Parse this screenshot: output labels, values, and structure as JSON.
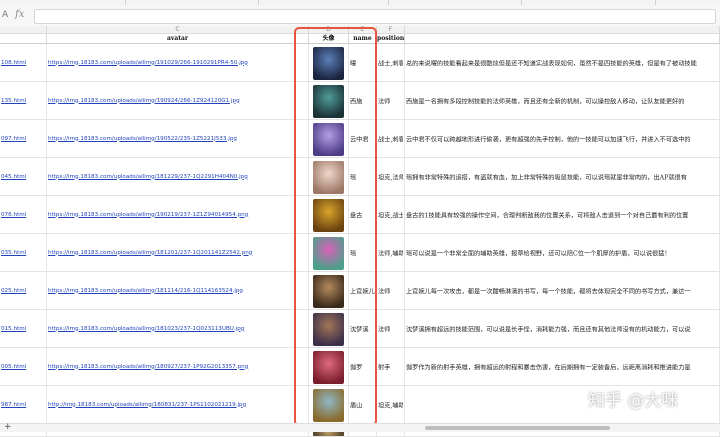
{
  "formula_bar": {
    "cell_ref": "A",
    "fx_label": "fx",
    "value": ""
  },
  "column_letters": [
    {
      "id": "C",
      "label": "C"
    },
    {
      "id": "D",
      "label": "D"
    },
    {
      "id": "E",
      "label": "E"
    },
    {
      "id": "F",
      "label": "F"
    }
  ],
  "headers": {
    "url": "",
    "avatar": "avatar",
    "avatar_cn": "头像",
    "name": "name",
    "position": "position",
    "desc": ""
  },
  "rows": [
    {
      "url": "108.html",
      "avatar_link": "https://img.18183.com/uploads/allimg/191029/266-1910291PR4-50.jpg",
      "name": "曜",
      "position": "战士,刺客",
      "desc": "总的来说曜的技能看起来是很酷炫但是还不知道实战表现如何，虽然不是四技能的英雄，但是有了被动技能",
      "avatar_color": "#5a7fb8",
      "avatar_color2": "#1b2540"
    },
    {
      "url": "135.html",
      "avatar_link": "https://img.18183.com/uploads/allimg/190924/266-1Z924120G1.jpg",
      "name": "西施",
      "position": "法师",
      "desc": "西施是一名拥有多段控制技能的法师英雄，而且还有全新的机制，可以操控敌人移动，让队友能更好的",
      "avatar_color": "#4f9b99",
      "avatar_color2": "#1c3136"
    },
    {
      "url": "097.html",
      "avatar_link": "https://img.18183.com/uploads/allimg/190522/235-1Z5221J533.jpg",
      "name": "云中君",
      "position": "战士,刺客",
      "desc": "云中君不仅可以跨越地形进行偷袭，更有超强的先手控制，他的一技能可以加速飞行，并进入不可选中的",
      "avatar_color": "#b1a0e4",
      "avatar_color2": "#4d3c86"
    },
    {
      "url": "045.html",
      "avatar_link": "https://img.18183.com/uploads/allimg/181229/237-1Q2291H404N0.jpg",
      "name": "瑶",
      "position": "坦克,法师",
      "desc": "瑶拥有非常特殊的追搭，有盗就有血，加上非常特殊的吸鼠技能，可以说瑶就是非常肉的，出AP就很有",
      "avatar_color": "#efd8cb",
      "avatar_color2": "#9c7766"
    },
    {
      "url": "076.html",
      "avatar_link": "https://img.18183.com/uploads/allimg/190219/237-1Z1Z94014954.png",
      "name": "盘古",
      "position": "坦克,战士",
      "desc": "盘古的1技能具有较强的操作空间，合理判断敌我的位置关系，可将敌人击退到一个对自己最有利的位置",
      "avatar_color": "#d9a52c",
      "avatar_color2": "#6a4210"
    },
    {
      "url": "035.html",
      "avatar_link": "https://img.18183.com/uploads/allimg/181201/237-1Q201141Z2542.png",
      "name": "瑶",
      "position": "法师,辅助",
      "desc": "瑶可以说是一个非常全面的辅助英雄，报草给视野，还可以陪C位一个肌厚的护盾，可以说很猛！",
      "avatar_color": "#d861b8",
      "avatar_color2": "#4aa08a"
    },
    {
      "url": "025.html",
      "avatar_link": "https://img.18183.com/uploads/allimg/181114/216-1Q114163524.jpg",
      "name": "上官婉儿",
      "position": "法师",
      "desc": "上官婉儿每一次攻击，都是一次酣畅淋漓的书写，每一个技能，都将去体现完全不同的书写方式，兼达一",
      "avatar_color": "#b38a5d",
      "avatar_color2": "#3a2a1c"
    },
    {
      "url": "015.html",
      "avatar_link": "https://img.18183.com/uploads/allimg/181023/237-1Q023113UBU.jpg",
      "name": "沈梦溪",
      "position": "法师",
      "desc": "沈梦溪拥有超远的技能范围，可以说是长手怪，消耗能力强，而且还有其他法师没有的机动能力，可以说",
      "avatar_color": "#a27658",
      "avatar_color2": "#3b2f4a"
    },
    {
      "url": "005.html",
      "avatar_link": "https://img.18183.com/uploads/allimg/180927/237-1P92G2013357.png",
      "name": "伽罗",
      "position": "射手",
      "desc": "伽罗作为新的射手英雄，拥有超远的射程和暴击伤害，在后期拥有一定装备后，远距离消耗和推进能力是",
      "avatar_color": "#dd6a7c",
      "avatar_color2": "#7a1d2c"
    },
    {
      "url": "987.html",
      "avatar_link": "http://img.18183.com/uploads/allimg/180831/237-1PS1102021219.jpg",
      "name": "盾山",
      "position": "坦克,辅助",
      "desc": "",
      "avatar_color": "#8fb8c8",
      "avatar_color2": "#8a6a2a"
    },
    {
      "url": "",
      "avatar_link": "",
      "name": "",
      "position": "",
      "desc": "",
      "avatar_color": "#c7a46c",
      "avatar_color2": "#5a4a30"
    }
  ],
  "scrollbar": {
    "add_label": "+"
  },
  "watermark": "知乎 @大咪"
}
